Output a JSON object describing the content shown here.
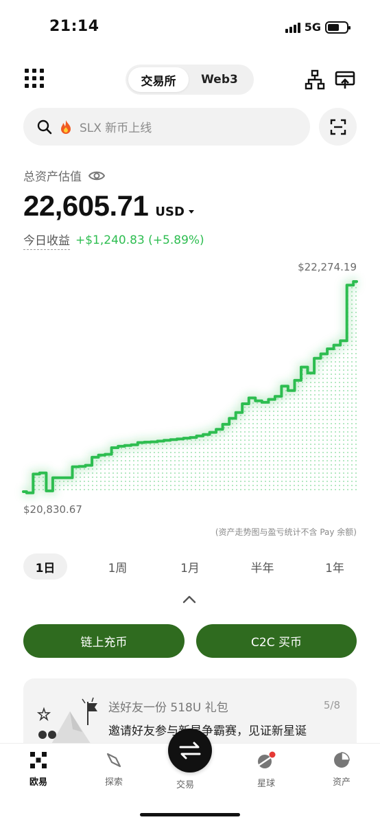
{
  "status": {
    "time": "21:14",
    "network": "5G"
  },
  "top": {
    "tab_exchange": "交易所",
    "tab_web3": "Web3"
  },
  "search": {
    "placeholder": "SLX 新币上线"
  },
  "balance": {
    "label": "总资产估值",
    "value": "22,605.71",
    "currency": "USD",
    "pnl_label": "今日收益",
    "pnl_value": "+$1,240.83 (+5.89%)"
  },
  "chart_data": {
    "type": "line",
    "max_label": "$22,274.19",
    "min_label": "$20,830.67",
    "note": "(资产走势图与盈亏统计不含 Pay 余额)",
    "ylim": [
      20830.67,
      22274.19
    ],
    "color": "#2dbd50",
    "values": [
      20840,
      20832,
      20960,
      20968,
      20845,
      20935,
      20935,
      20935,
      21010,
      21012,
      21020,
      21075,
      21090,
      21095,
      21140,
      21150,
      21155,
      21160,
      21175,
      21178,
      21180,
      21185,
      21190,
      21195,
      21200,
      21205,
      21210,
      21220,
      21230,
      21245,
      21265,
      21300,
      21340,
      21380,
      21440,
      21480,
      21460,
      21450,
      21470,
      21490,
      21560,
      21530,
      21600,
      21690,
      21650,
      21750,
      21780,
      21815,
      21840,
      21870,
      22250,
      22274
    ]
  },
  "ranges": [
    "1日",
    "1周",
    "1月",
    "半年",
    "1年"
  ],
  "actions": {
    "deposit": "链上充币",
    "c2c": "C2C 买币"
  },
  "promo": {
    "title": "送好友一份 518U 礼包",
    "page": "5/8",
    "desc": "邀请好友参与新星争霸赛，见证新星诞"
  },
  "tabs": {
    "home": "欧易",
    "explore": "探索",
    "trade": "交易",
    "planet": "星球",
    "assets": "资产"
  },
  "colors": {
    "accent": "#2dbd50",
    "button": "#2f6b1f"
  }
}
